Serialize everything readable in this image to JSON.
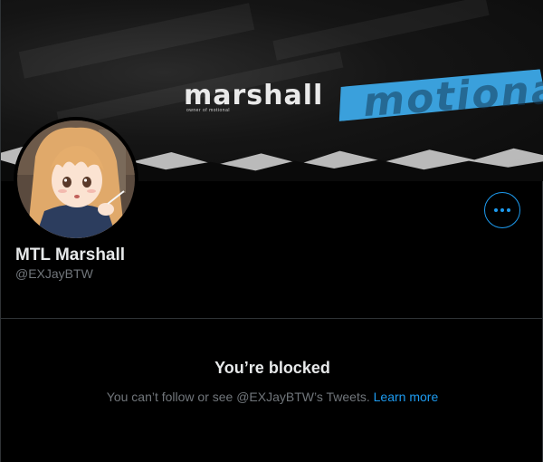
{
  "banner": {
    "brand": "marshall",
    "brand_sub": "owner of motional",
    "tape_text": "motional"
  },
  "profile": {
    "display_name": "MTL Marshall",
    "handle": "@EXJayBTW"
  },
  "blocked": {
    "title": "You’re blocked",
    "description": "You can’t follow or see @EXJayBTW’s Tweets.",
    "link": "Learn more"
  },
  "colors": {
    "accent": "#1d9bf0",
    "background": "#000000",
    "secondary_text": "#71767b",
    "primary_text": "#e7e9ea",
    "banner_tape": "#3aa0dc"
  },
  "icons": {
    "more": "more-icon"
  }
}
